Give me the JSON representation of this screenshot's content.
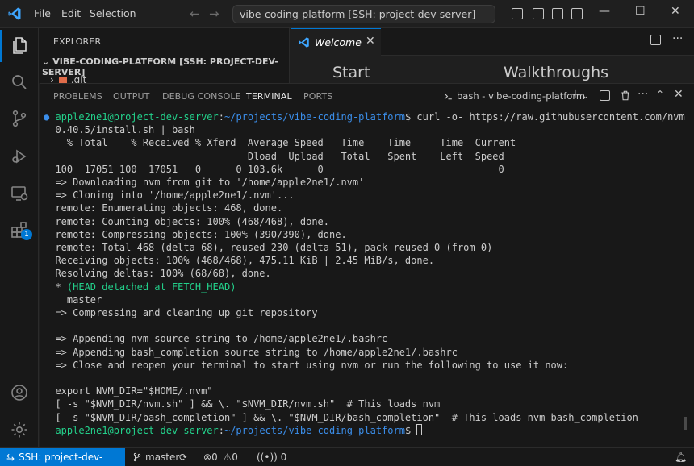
{
  "titlebar": {
    "menu": [
      "File",
      "Edit",
      "Selection"
    ],
    "search_text": "vibe-coding-platform [SSH: project-dev-server]",
    "back_arrow": "←",
    "forward_arrow": "→",
    "minimize": "—",
    "maximize": "☐",
    "close": "✕"
  },
  "activity": {
    "extensions_badge": "1"
  },
  "sidebar": {
    "title": "EXPLORER",
    "folder": "VIBE-CODING-PLATFORM [SSH: PROJECT-DEV-SERVER]",
    "first_item": ".git"
  },
  "editor": {
    "tab_label": "Welcome",
    "tab_close": "✕",
    "heading_start": "Start",
    "heading_walkthroughs": "Walkthroughs"
  },
  "panel": {
    "tabs": [
      "PROBLEMS",
      "OUTPUT",
      "DEBUG CONSOLE",
      "TERMINAL",
      "PORTS"
    ],
    "terminal_name": "bash - vibe-coding-platform",
    "more": "···",
    "close": "✕"
  },
  "terminal": {
    "user": "apple2ne1@project-dev-server",
    "path": "~/projects/vibe-coding-platform",
    "prompt_symbol": "$",
    "command_line1": " curl -o- https://raw.githubusercontent.com/nvm-sh/nvm/v",
    "command_line2": "0.40.5/install.sh | bash",
    "lines": [
      "  % Total    % Received % Xferd  Average Speed   Time    Time     Time  Current",
      "                                 Dload  Upload   Total   Spent    Left  Speed",
      "100  17051 100  17051   0      0 103.6k      0                              0",
      "=> Downloading nvm from git to '/home/apple2ne1/.nvm'",
      "=> Cloning into '/home/apple2ne1/.nvm'...",
      "remote: Enumerating objects: 468, done.",
      "remote: Counting objects: 100% (468/468), done.",
      "remote: Compressing objects: 100% (390/390), done.",
      "remote: Total 468 (delta 68), reused 230 (delta 51), pack-reused 0 (from 0)",
      "Receiving objects: 100% (468/468), 475.11 KiB | 2.45 MiB/s, done.",
      "Resolving deltas: 100% (68/68), done."
    ],
    "head_star": "*",
    "head_detached": " (HEAD detached at FETCH_HEAD)",
    "lines2": [
      "  master",
      "=> Compressing and cleaning up git repository",
      "",
      "=> Appending nvm source string to /home/apple2ne1/.bashrc",
      "=> Appending bash_completion source string to /home/apple2ne1/.bashrc",
      "=> Close and reopen your terminal to start using nvm or run the following to use it now:",
      "",
      "export NVM_DIR=\"$HOME/.nvm\"",
      "[ -s \"$NVM_DIR/nvm.sh\" ] && \\. \"$NVM_DIR/nvm.sh\"  # This loads nvm",
      "[ -s \"$NVM_DIR/bash_completion\" ] && \\. \"$NVM_DIR/bash_completion\"  # This loads nvm bash_completion"
    ]
  },
  "statusbar": {
    "remote": "SSH: project-dev-server",
    "branch": "master",
    "errors": "0",
    "warnings": "0",
    "ports": "0"
  },
  "colors": {
    "accent": "#0078d4",
    "prompt_green": "#23d18b",
    "path_blue": "#3b8eea"
  }
}
